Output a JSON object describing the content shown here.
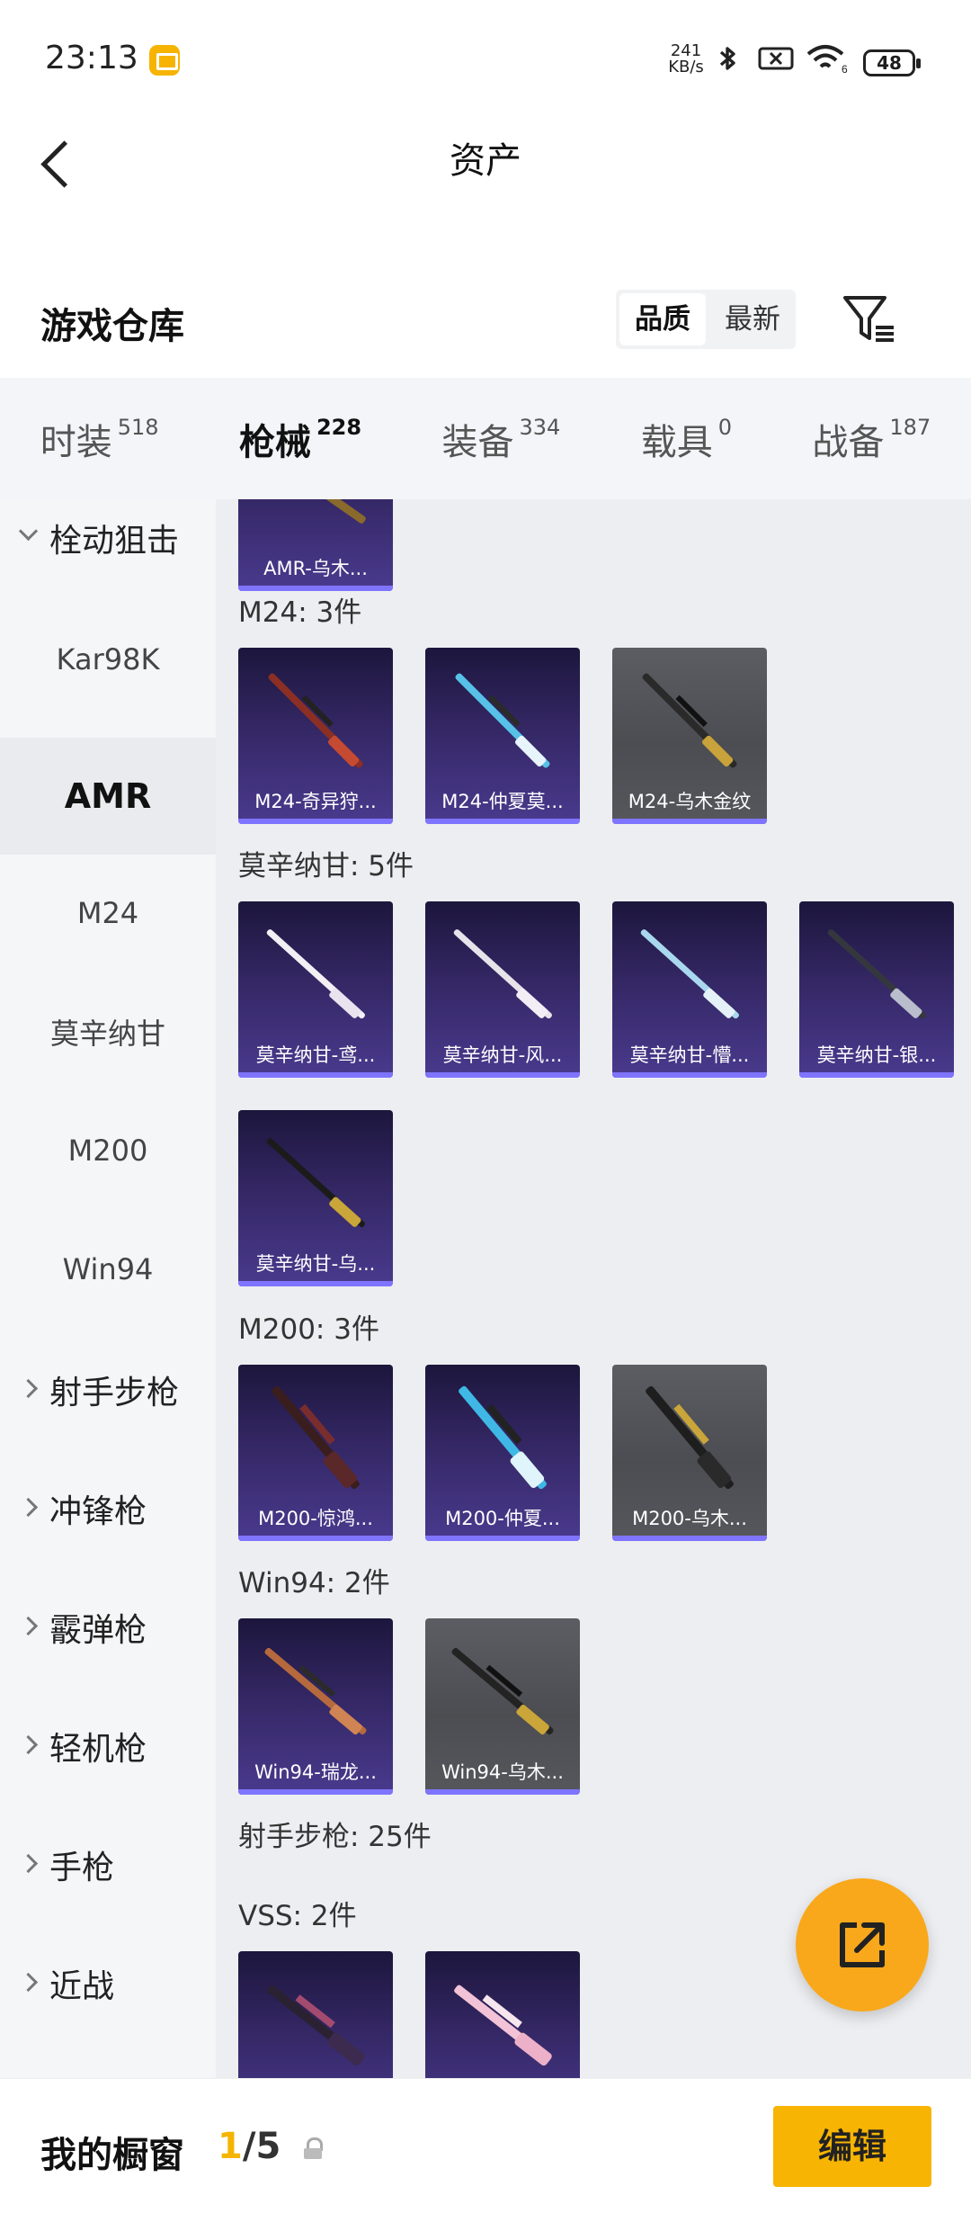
{
  "status_bar": {
    "time": "23:13",
    "net_speed": "241",
    "net_unit": "KB/s",
    "battery": "48",
    "wifi_level": "6"
  },
  "header": {
    "title": "资产",
    "section": "游戏仓库",
    "sort": [
      "品质",
      "最新"
    ],
    "filter_icon": "filter-icon"
  },
  "tabs": [
    {
      "label": "时装",
      "count": "518"
    },
    {
      "label": "枪械",
      "count": "228"
    },
    {
      "label": "装备",
      "count": "334"
    },
    {
      "label": "载具",
      "count": "0"
    },
    {
      "label": "战备",
      "count": "187"
    }
  ],
  "sidebar": [
    {
      "label": "栓动狙击"
    },
    {
      "label": "Kar98K"
    },
    {
      "label": "AMR"
    },
    {
      "label": "M24"
    },
    {
      "label": "莫辛纳甘"
    },
    {
      "label": "M200"
    },
    {
      "label": "Win94"
    },
    {
      "label": "射手步枪"
    },
    {
      "label": "冲锋枪"
    },
    {
      "label": "霰弹枪"
    },
    {
      "label": "轻机枪"
    },
    {
      "label": "手枪"
    },
    {
      "label": "近战"
    }
  ],
  "groups": {
    "amr": {
      "items": [
        "AMR-乌木..."
      ]
    },
    "m24": {
      "label": "M24: 3件",
      "items": [
        "M24-奇异狩...",
        "M24-仲夏莫...",
        "M24-乌木金纹"
      ]
    },
    "mosin": {
      "label": "莫辛纳甘: 5件",
      "items": [
        "莫辛纳甘-鸢...",
        "莫辛纳甘-风...",
        "莫辛纳甘-懵...",
        "莫辛纳甘-银...",
        "莫辛纳甘-乌..."
      ]
    },
    "m200": {
      "label": "M200: 3件",
      "items": [
        "M200-惊鸿...",
        "M200-仲夏...",
        "M200-乌木..."
      ]
    },
    "win94": {
      "label": "Win94: 2件",
      "items": [
        "Win94-瑞龙...",
        "Win94-乌木..."
      ]
    },
    "dmr": {
      "label": "射手步枪: 25件"
    },
    "vss": {
      "label": "VSS: 2件"
    }
  },
  "bottom": {
    "title": "我的橱窗",
    "current": "1",
    "total": "/5",
    "edit": "编辑"
  },
  "colors": {
    "accent": "#f5b400",
    "fab": "#f9a81b",
    "card_purple": "#342764",
    "card_gray": "#5c5d63"
  }
}
